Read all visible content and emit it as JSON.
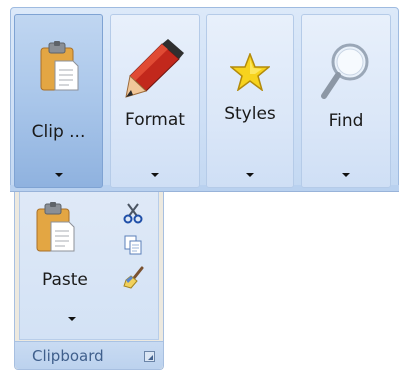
{
  "ribbon": {
    "groups": [
      {
        "label": "Clip ...",
        "icon": "clipboard-icon",
        "state": "pressed"
      },
      {
        "label": "Format",
        "icon": "pencil-icon"
      },
      {
        "label": "Styles",
        "icon": "star-icon"
      },
      {
        "label": "Find",
        "icon": "magnifier-icon"
      }
    ]
  },
  "popup": {
    "title": "Clipboard",
    "paste_label": "Paste",
    "small_buttons": [
      "cut-icon",
      "copy-icon",
      "format-painter-icon"
    ],
    "launcher_icon": "dialog-launcher-icon"
  }
}
